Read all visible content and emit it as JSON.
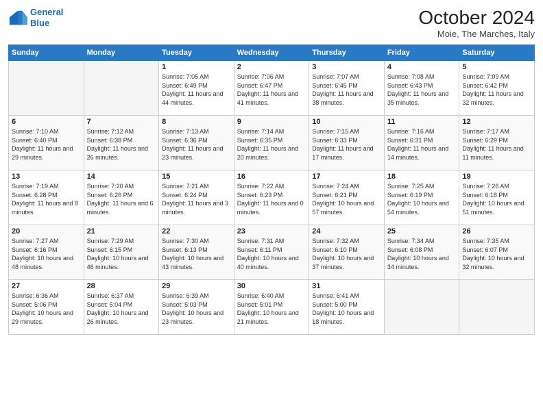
{
  "header": {
    "logo_line1": "General",
    "logo_line2": "Blue",
    "month": "October 2024",
    "location": "Moie, The Marches, Italy"
  },
  "weekdays": [
    "Sunday",
    "Monday",
    "Tuesday",
    "Wednesday",
    "Thursday",
    "Friday",
    "Saturday"
  ],
  "weeks": [
    [
      {
        "day": null,
        "data": null
      },
      {
        "day": null,
        "data": null
      },
      {
        "day": 1,
        "data": "Sunrise: 7:05 AM\nSunset: 6:49 PM\nDaylight: 11 hours and 44 minutes."
      },
      {
        "day": 2,
        "data": "Sunrise: 7:06 AM\nSunset: 6:47 PM\nDaylight: 11 hours and 41 minutes."
      },
      {
        "day": 3,
        "data": "Sunrise: 7:07 AM\nSunset: 6:45 PM\nDaylight: 11 hours and 38 minutes."
      },
      {
        "day": 4,
        "data": "Sunrise: 7:08 AM\nSunset: 6:43 PM\nDaylight: 11 hours and 35 minutes."
      },
      {
        "day": 5,
        "data": "Sunrise: 7:09 AM\nSunset: 6:42 PM\nDaylight: 11 hours and 32 minutes."
      }
    ],
    [
      {
        "day": 6,
        "data": "Sunrise: 7:10 AM\nSunset: 6:40 PM\nDaylight: 11 hours and 29 minutes."
      },
      {
        "day": 7,
        "data": "Sunrise: 7:12 AM\nSunset: 6:38 PM\nDaylight: 11 hours and 26 minutes."
      },
      {
        "day": 8,
        "data": "Sunrise: 7:13 AM\nSunset: 6:36 PM\nDaylight: 11 hours and 23 minutes."
      },
      {
        "day": 9,
        "data": "Sunrise: 7:14 AM\nSunset: 6:35 PM\nDaylight: 11 hours and 20 minutes."
      },
      {
        "day": 10,
        "data": "Sunrise: 7:15 AM\nSunset: 6:33 PM\nDaylight: 11 hours and 17 minutes."
      },
      {
        "day": 11,
        "data": "Sunrise: 7:16 AM\nSunset: 6:31 PM\nDaylight: 11 hours and 14 minutes."
      },
      {
        "day": 12,
        "data": "Sunrise: 7:17 AM\nSunset: 6:29 PM\nDaylight: 11 hours and 11 minutes."
      }
    ],
    [
      {
        "day": 13,
        "data": "Sunrise: 7:19 AM\nSunset: 6:28 PM\nDaylight: 11 hours and 8 minutes."
      },
      {
        "day": 14,
        "data": "Sunrise: 7:20 AM\nSunset: 6:26 PM\nDaylight: 11 hours and 6 minutes."
      },
      {
        "day": 15,
        "data": "Sunrise: 7:21 AM\nSunset: 6:24 PM\nDaylight: 11 hours and 3 minutes."
      },
      {
        "day": 16,
        "data": "Sunrise: 7:22 AM\nSunset: 6:23 PM\nDaylight: 11 hours and 0 minutes."
      },
      {
        "day": 17,
        "data": "Sunrise: 7:24 AM\nSunset: 6:21 PM\nDaylight: 10 hours and 57 minutes."
      },
      {
        "day": 18,
        "data": "Sunrise: 7:25 AM\nSunset: 6:19 PM\nDaylight: 10 hours and 54 minutes."
      },
      {
        "day": 19,
        "data": "Sunrise: 7:26 AM\nSunset: 6:18 PM\nDaylight: 10 hours and 51 minutes."
      }
    ],
    [
      {
        "day": 20,
        "data": "Sunrise: 7:27 AM\nSunset: 6:16 PM\nDaylight: 10 hours and 48 minutes."
      },
      {
        "day": 21,
        "data": "Sunrise: 7:29 AM\nSunset: 6:15 PM\nDaylight: 10 hours and 46 minutes."
      },
      {
        "day": 22,
        "data": "Sunrise: 7:30 AM\nSunset: 6:13 PM\nDaylight: 10 hours and 43 minutes."
      },
      {
        "day": 23,
        "data": "Sunrise: 7:31 AM\nSunset: 6:11 PM\nDaylight: 10 hours and 40 minutes."
      },
      {
        "day": 24,
        "data": "Sunrise: 7:32 AM\nSunset: 6:10 PM\nDaylight: 10 hours and 37 minutes."
      },
      {
        "day": 25,
        "data": "Sunrise: 7:34 AM\nSunset: 6:08 PM\nDaylight: 10 hours and 34 minutes."
      },
      {
        "day": 26,
        "data": "Sunrise: 7:35 AM\nSunset: 6:07 PM\nDaylight: 10 hours and 32 minutes."
      }
    ],
    [
      {
        "day": 27,
        "data": "Sunrise: 6:36 AM\nSunset: 5:06 PM\nDaylight: 10 hours and 29 minutes."
      },
      {
        "day": 28,
        "data": "Sunrise: 6:37 AM\nSunset: 5:04 PM\nDaylight: 10 hours and 26 minutes."
      },
      {
        "day": 29,
        "data": "Sunrise: 6:39 AM\nSunset: 5:03 PM\nDaylight: 10 hours and 23 minutes."
      },
      {
        "day": 30,
        "data": "Sunrise: 6:40 AM\nSunset: 5:01 PM\nDaylight: 10 hours and 21 minutes."
      },
      {
        "day": 31,
        "data": "Sunrise: 6:41 AM\nSunset: 5:00 PM\nDaylight: 10 hours and 18 minutes."
      },
      {
        "day": null,
        "data": null
      },
      {
        "day": null,
        "data": null
      }
    ]
  ]
}
